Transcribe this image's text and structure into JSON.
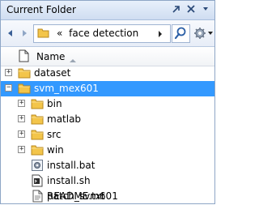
{
  "panel": {
    "title": "Current Folder",
    "title_buttons": [
      "undock-icon",
      "close-icon",
      "menu-arrow-icon"
    ]
  },
  "address": {
    "path_prefix": "«",
    "folder": "face detection"
  },
  "columns": {
    "name": "Name"
  },
  "tree": {
    "dataset": "dataset",
    "svm_mex601": "svm_mex601",
    "bin": "bin",
    "matlab": "matlab",
    "src": "src",
    "win": "win",
    "install_bat": "install.bat",
    "install_sh": "install.sh",
    "patch_svm601": "patch_svm601",
    "readme": "README.txt"
  },
  "colors": {
    "selection": "#3399ff",
    "folder": "#f3c54a",
    "title_gradient_top": "#e8f0fb"
  }
}
